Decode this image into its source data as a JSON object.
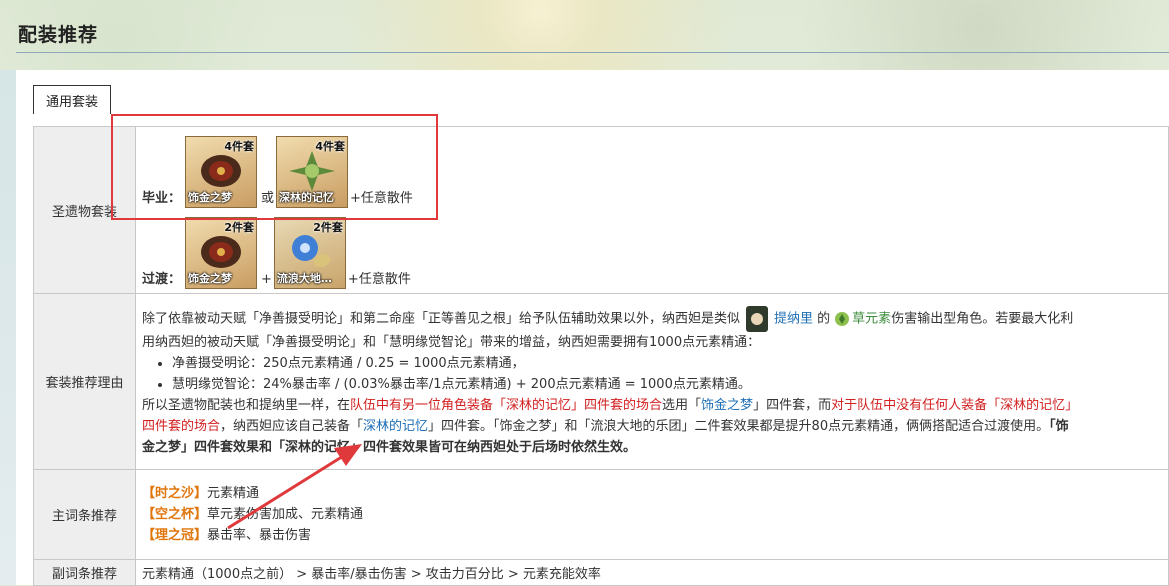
{
  "header": {
    "title": "配装推荐"
  },
  "tab": {
    "label": "通用套装"
  },
  "rows": {
    "artifact_label": "圣遗物套装",
    "reason_label": "套装推荐理由",
    "main_label": "主词条推荐",
    "sub_label": "副词条推荐"
  },
  "best": {
    "label": "毕业：",
    "set1": {
      "count": "4件套",
      "name": "饰金之梦"
    },
    "or": "或",
    "set2": {
      "count": "4件套",
      "name": "深林的记忆"
    },
    "tail": "+任意散件"
  },
  "transition": {
    "label": "过渡：",
    "set1": {
      "count": "2件套",
      "name": "饰金之梦"
    },
    "plus": "+",
    "set2": {
      "count": "2件套",
      "name": "流浪大地…"
    },
    "tail": "+任意散件"
  },
  "reason": {
    "p1a": "除了依靠被动天赋「净善摄受明论」和第二命座「正等善见之根」给予队伍辅助效果以外，纳西妲是类似",
    "p1_link": "提纳里",
    "p1b": " 的",
    "p1_elem": "草元素",
    "p1c": "伤害输出型角色。若要最大化利",
    "p2": "用纳西妲的被动天赋「净善摄受明论」和「慧明缘觉智论」带来的增益，纳西妲需要拥有1000点元素精通：",
    "b1": "净善摄受明论：250点元素精通 / 0.25 = 1000点元素精通，",
    "b2": "慧明缘觉智论：24%暴击率 / (0.03%暴击率/1点元素精通) + 200点元素精通 = 1000点元素精通。",
    "p3a": "所以圣遗物配装也和提纳里一样，在",
    "p3_red1": "队伍中有另一位角色装备「深林的记忆」四件套的场合",
    "p3b": "选用「",
    "p3_blue1": "饰金之梦",
    "p3c": "」四件套，而",
    "p3_red2": "对于队伍中没有任何人装备「深林的记忆」",
    "p4_red": "四件套的场合",
    "p4a": "，纳西妲应该自己装备「",
    "p4_blue": "深林的记忆",
    "p4b": "」四件套。「饰金之梦」和「流浪大地的乐团」二件套效果都是提升80点元素精通，俩俩搭配适合过渡使用。",
    "p4_bold": "「饰",
    "p5_bold": "金之梦」四件套效果和「深林的记忆」四件套效果皆可在纳西妲处于后场时依然生效。"
  },
  "main": {
    "l1_tag": "【时之沙】",
    "l1_val": "元素精通",
    "l2_tag": "【空之杯】",
    "l2_val": "草元素伤害加成、元素精通",
    "l3_tag": "【理之冠】",
    "l3_val": "暴击率、暴击伤害"
  },
  "sub": {
    "value": "元素精通（1000点之前） > 暴击率/暴击伤害 > 攻击力百分比 > 元素充能效率"
  },
  "colors": {
    "annotation_red": "#e0393c",
    "link_blue": "#1f6fb5",
    "highlight_red": "#d21f1f",
    "tag_orange": "#e0760c",
    "dendro_green": "#3c8c3c"
  }
}
